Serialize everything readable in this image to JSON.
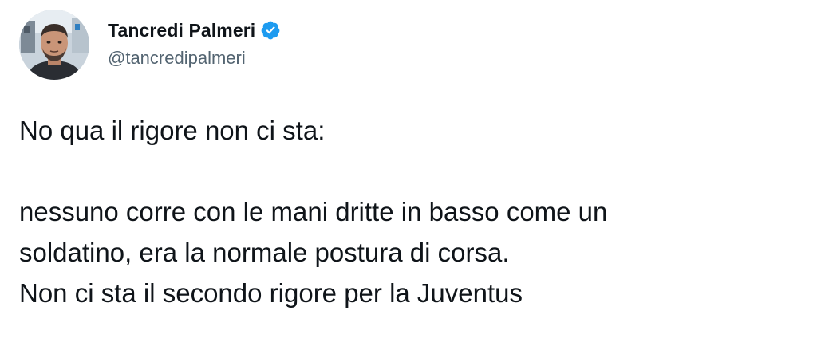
{
  "author": {
    "display_name": "Tancredi Palmeri",
    "handle": "@tancredipalmeri",
    "verified": true,
    "avatar_icon": "profile-photo"
  },
  "tweet": {
    "lines": [
      "No qua il rigore non ci sta:",
      "",
      "nessuno corre con le mani dritte in basso come un",
      "soldatino, era la normale postura di corsa.",
      "Non ci sta il secondo rigore per la Juventus"
    ]
  },
  "colors": {
    "text": "#0f1419",
    "secondary": "#536471",
    "verified_badge": "#1d9bf0"
  }
}
